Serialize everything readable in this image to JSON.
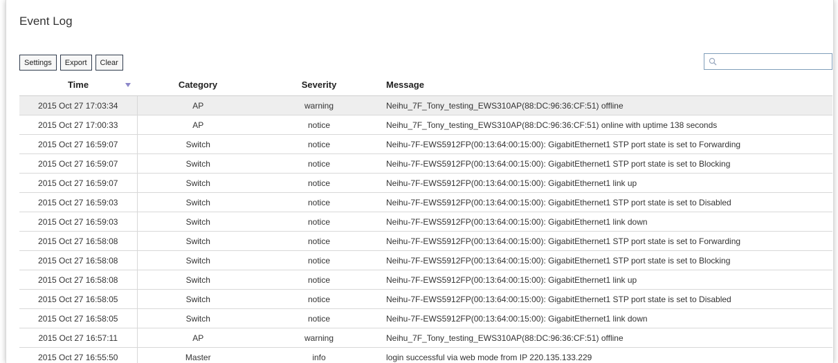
{
  "page_title": "Event Log",
  "toolbar": {
    "settings_label": "Settings",
    "export_label": "Export",
    "clear_label": "Clear"
  },
  "search": {
    "value": "",
    "icon": "magnifier-icon"
  },
  "table": {
    "columns": [
      "Time",
      "Category",
      "Severity",
      "Message"
    ],
    "sort": {
      "column": "Time",
      "direction": "descending"
    },
    "rows": [
      {
        "time": "2015 Oct 27 17:03:34",
        "category": "AP",
        "severity": "warning",
        "message": "Neihu_7F_Tony_testing_EWS310AP(88:DC:96:36:CF:51) offline"
      },
      {
        "time": "2015 Oct 27 17:00:33",
        "category": "AP",
        "severity": "notice",
        "message": "Neihu_7F_Tony_testing_EWS310AP(88:DC:96:36:CF:51) online with uptime 138 seconds"
      },
      {
        "time": "2015 Oct 27 16:59:07",
        "category": "Switch",
        "severity": "notice",
        "message": "Neihu-7F-EWS5912FP(00:13:64:00:15:00): GigabitEthernet1 STP port state is set to Forwarding"
      },
      {
        "time": "2015 Oct 27 16:59:07",
        "category": "Switch",
        "severity": "notice",
        "message": "Neihu-7F-EWS5912FP(00:13:64:00:15:00): GigabitEthernet1 STP port state is set to Blocking"
      },
      {
        "time": "2015 Oct 27 16:59:07",
        "category": "Switch",
        "severity": "notice",
        "message": "Neihu-7F-EWS5912FP(00:13:64:00:15:00): GigabitEthernet1 link up"
      },
      {
        "time": "2015 Oct 27 16:59:03",
        "category": "Switch",
        "severity": "notice",
        "message": "Neihu-7F-EWS5912FP(00:13:64:00:15:00): GigabitEthernet1 STP port state is set to Disabled"
      },
      {
        "time": "2015 Oct 27 16:59:03",
        "category": "Switch",
        "severity": "notice",
        "message": "Neihu-7F-EWS5912FP(00:13:64:00:15:00): GigabitEthernet1 link down"
      },
      {
        "time": "2015 Oct 27 16:58:08",
        "category": "Switch",
        "severity": "notice",
        "message": "Neihu-7F-EWS5912FP(00:13:64:00:15:00): GigabitEthernet1 STP port state is set to Forwarding"
      },
      {
        "time": "2015 Oct 27 16:58:08",
        "category": "Switch",
        "severity": "notice",
        "message": "Neihu-7F-EWS5912FP(00:13:64:00:15:00): GigabitEthernet1 STP port state is set to Blocking"
      },
      {
        "time": "2015 Oct 27 16:58:08",
        "category": "Switch",
        "severity": "notice",
        "message": "Neihu-7F-EWS5912FP(00:13:64:00:15:00): GigabitEthernet1 link up"
      },
      {
        "time": "2015 Oct 27 16:58:05",
        "category": "Switch",
        "severity": "notice",
        "message": "Neihu-7F-EWS5912FP(00:13:64:00:15:00): GigabitEthernet1 STP port state is set to Disabled"
      },
      {
        "time": "2015 Oct 27 16:58:05",
        "category": "Switch",
        "severity": "notice",
        "message": "Neihu-7F-EWS5912FP(00:13:64:00:15:00): GigabitEthernet1 link down"
      },
      {
        "time": "2015 Oct 27 16:57:11",
        "category": "AP",
        "severity": "warning",
        "message": "Neihu_7F_Tony_testing_EWS310AP(88:DC:96:36:CF:51) offline"
      },
      {
        "time": "2015 Oct 27 16:55:50",
        "category": "Master",
        "severity": "info",
        "message": "login successful via web mode from IP 220.135.133.229"
      }
    ]
  },
  "colors": {
    "header_row_bg": "#eeeeee",
    "button_border": "#2f3a4c",
    "sort_arrow": "#8b86c9",
    "search_border": "#7f9db9"
  }
}
